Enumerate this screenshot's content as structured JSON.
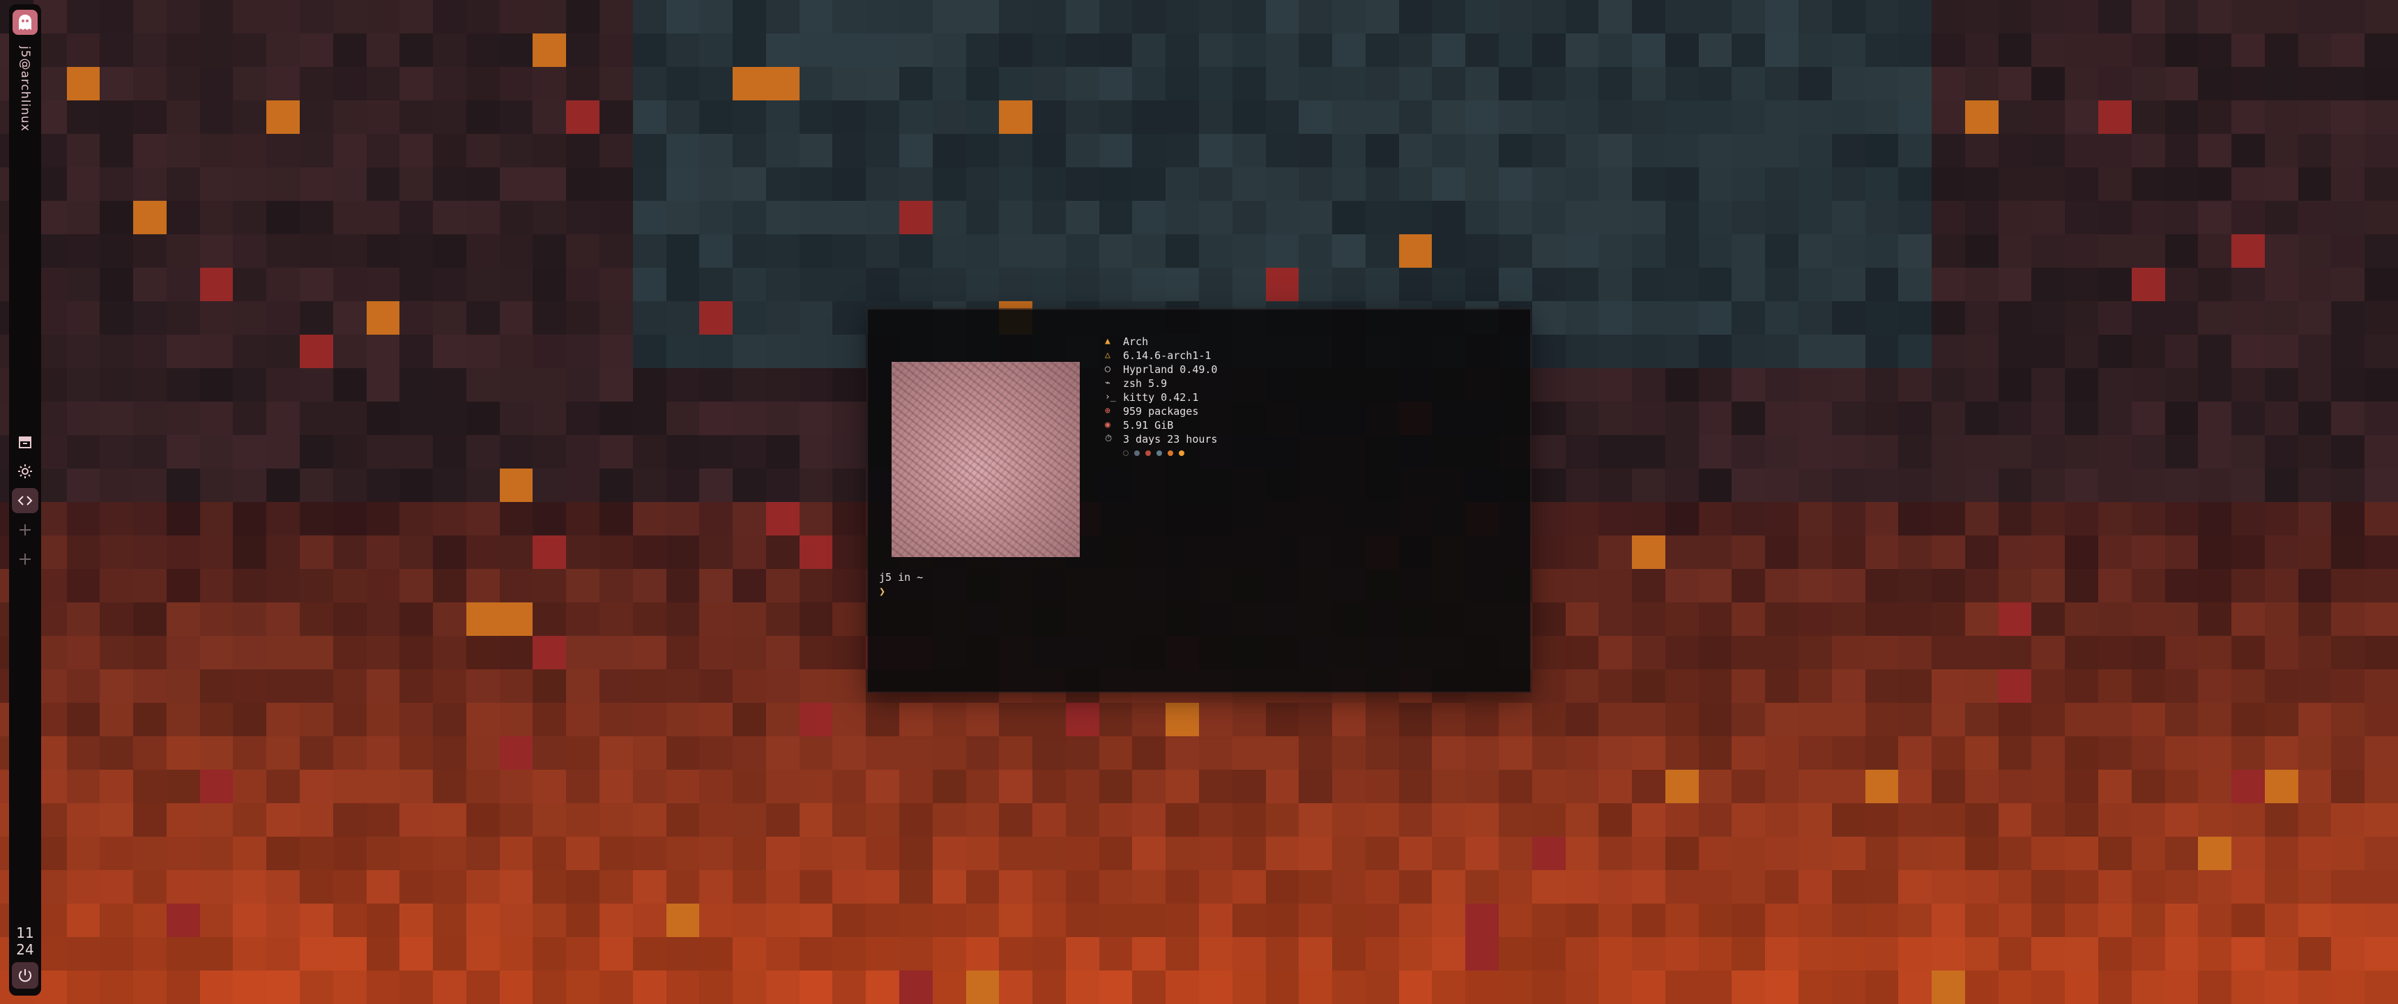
{
  "sidebar": {
    "vertical_text": "j5@archlinux",
    "workspace_icons": [
      "archive-icon",
      "sun-icon",
      "code-icon",
      "plus-icon",
      "plus-icon"
    ],
    "clock": {
      "hour": "11",
      "minute": "24"
    },
    "accent_color": "#c86b7a"
  },
  "terminal": {
    "fetch": [
      {
        "icon": "arch-icon",
        "color": "#e8a23a",
        "text": "Arch"
      },
      {
        "icon": "kernel-icon",
        "color": "#e8a23a",
        "text": "6.14.6-arch1-1"
      },
      {
        "icon": "wm-icon",
        "color": "#cfcfcf",
        "text": "Hyprland 0.49.0"
      },
      {
        "icon": "shell-icon",
        "color": "#cfcfcf",
        "text": "zsh 5.9"
      },
      {
        "icon": "terminal-icon",
        "color": "#cfcfcf",
        "text": "kitty 0.42.1"
      },
      {
        "icon": "package-icon",
        "color": "#e36b5a",
        "text": "959 packages"
      },
      {
        "icon": "memory-icon",
        "color": "#e36b5a",
        "text": "5.91 GiB"
      },
      {
        "icon": "uptime-icon",
        "color": "#cfcfcf",
        "text": "3 days 23 hours"
      }
    ],
    "palette": [
      "#3a3a3a",
      "#5a6b7a",
      "#b84b3b",
      "#5f7d8a",
      "#d9772a",
      "#f0a030"
    ],
    "prompt_line": "j5 in ~",
    "prompt_symbol": "❯"
  }
}
